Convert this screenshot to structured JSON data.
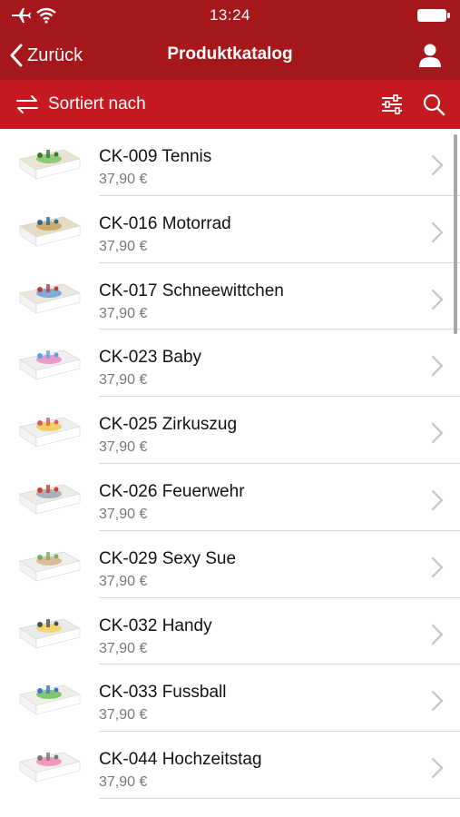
{
  "status_bar": {
    "time": "13:24"
  },
  "nav": {
    "back_label": "Zurück",
    "title": "Produktkatalog"
  },
  "sort_bar": {
    "label": "Sortiert nach"
  },
  "colors": {
    "nav_bg": "#a5171b",
    "sort_bg": "#c21a20",
    "price": "#777777"
  },
  "products": [
    {
      "name": "CK-009 Tennis",
      "price": "37,90 €",
      "thumb": "tennis-cake"
    },
    {
      "name": "CK-016 Motorrad",
      "price": "37,90 €",
      "thumb": "motorcycle-cake"
    },
    {
      "name": "CK-017 Schneewittchen",
      "price": "37,90 €",
      "thumb": "snow-white-cake"
    },
    {
      "name": "CK-023 Baby",
      "price": "37,90 €",
      "thumb": "baby-cake"
    },
    {
      "name": "CK-025 Zirkuszug",
      "price": "37,90 €",
      "thumb": "circus-train-cake"
    },
    {
      "name": "CK-026 Feuerwehr",
      "price": "37,90 €",
      "thumb": "fire-brigade-cake"
    },
    {
      "name": "CK-029 Sexy Sue",
      "price": "37,90 €",
      "thumb": "figure-cake"
    },
    {
      "name": "CK-032 Handy",
      "price": "37,90 €",
      "thumb": "phone-cake"
    },
    {
      "name": "CK-033 Fussball",
      "price": "37,90 €",
      "thumb": "football-cake"
    },
    {
      "name": "CK-044 Hochzeitstag",
      "price": "37,90 €",
      "thumb": "anniversary-cake"
    }
  ]
}
